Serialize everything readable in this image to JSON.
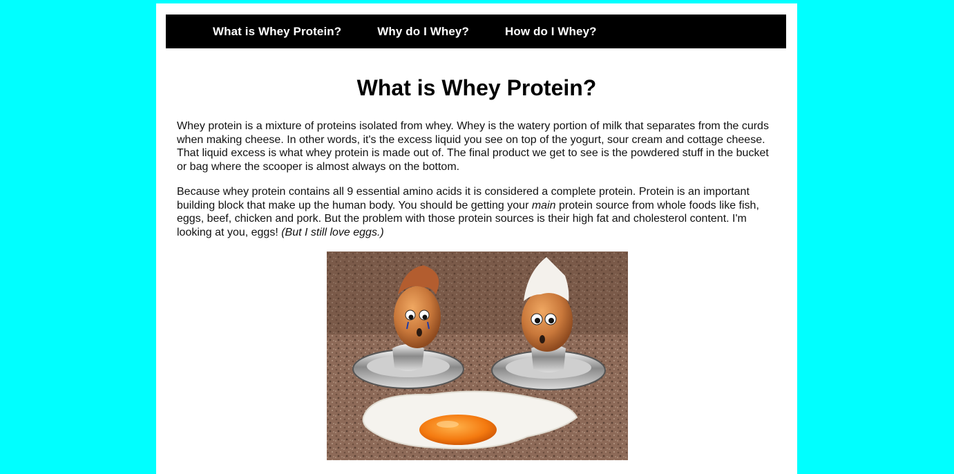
{
  "nav": {
    "items": [
      {
        "label": "What is Whey Protein?"
      },
      {
        "label": "Why do I Whey?"
      },
      {
        "label": "How do I Whey?"
      }
    ]
  },
  "main": {
    "title": "What is Whey Protein?",
    "paragraph1": "Whey protein is a mixture of proteins isolated from whey. Whey is the watery portion of milk that separates from the curds when making cheese. In other words, it's the excess liquid you see on top of the yogurt, sour cream and cottage cheese. That liquid excess is what whey protein is made out of. The final product we get to see is the powdered stuff in the bucket or bag where the scooper is almost always on the bottom.",
    "paragraph2": {
      "part1": "Because whey protein contains all 9 essential amino acids it is considered a complete protein. Protein is an important building block that make up the human body. You should be getting your ",
      "emphasis": "main",
      "part2": " protein source from whole foods like fish, eggs, beef, chicken and pork. But the problem with those protein sources is their high fat and cholesterol content. I'm looking at you, eggs! ",
      "aside": "(But I still love eggs.)"
    }
  },
  "colors": {
    "background": "#00ffff",
    "nav_bg": "#000000",
    "nav_text": "#ffffff"
  }
}
